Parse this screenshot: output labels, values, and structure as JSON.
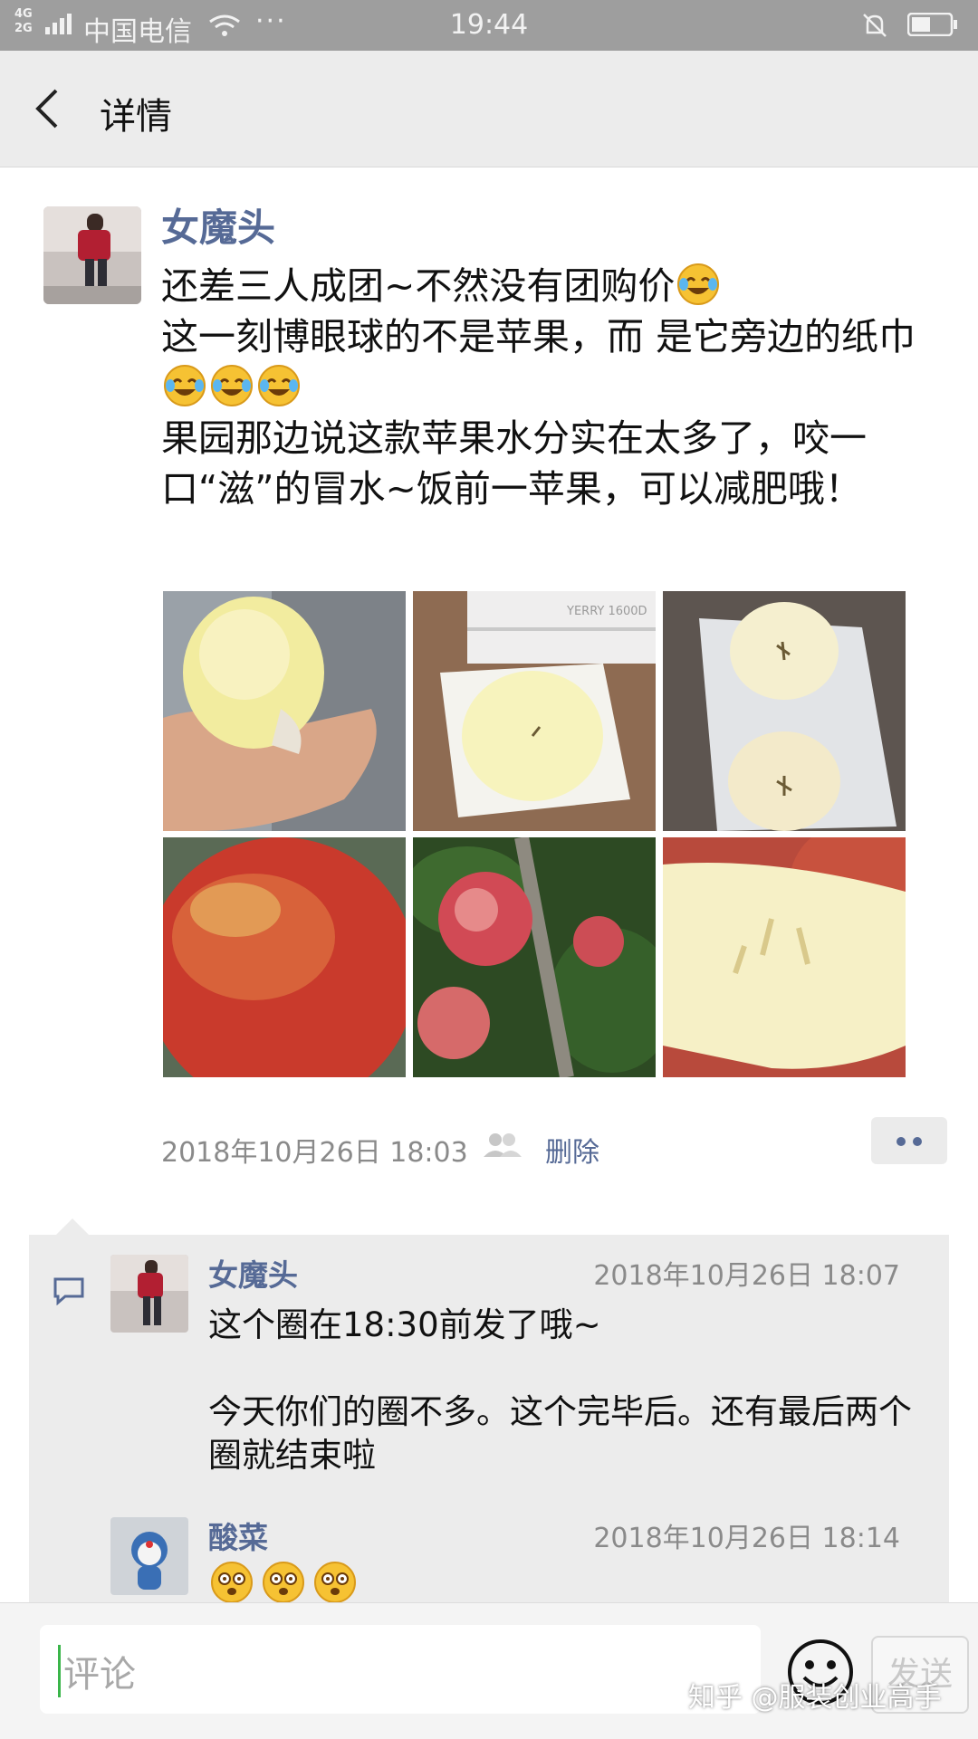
{
  "status_bar": {
    "network": "4G\n2G",
    "carrier": "中国电信",
    "dots": "···",
    "time": "19:44"
  },
  "nav": {
    "title": "详情"
  },
  "post": {
    "author": "女魔头",
    "text_line1": "还差三人成团~不然没有团购价",
    "text_line2": "这一刻博眼球的不是苹果，而 是它旁边的纸巾",
    "text_line3": "果园那边说这款苹果水分实在太多了，咬一口“滋”的冒水~饭前一苹果，可以减肥哦！",
    "time": "2018年10月26日 18:03",
    "delete_label": "删除",
    "images": [
      {
        "name": "apple-bitten-in-hand"
      },
      {
        "name": "apple-cut-on-napkin"
      },
      {
        "name": "apple-slices-on-plastic"
      },
      {
        "name": "red-apple-closeup"
      },
      {
        "name": "apples-on-tree"
      },
      {
        "name": "apple-cut-wedge"
      }
    ],
    "box_label": "YERRY 1600D"
  },
  "comments": [
    {
      "author": "女魔头",
      "time": "2018年10月26日 18:07",
      "text": "这个圈在18:30前发了哦~\n\n今天你们的圈不多。这个完毕后。还有最后两个圈就结束啦"
    },
    {
      "author": "酸菜",
      "time": "2018年10月26日 18:14",
      "emoji_count": 3
    }
  ],
  "input": {
    "placeholder": "评论",
    "send_label": "发送"
  },
  "watermark": "知乎 @服装创业高手",
  "colors": {
    "link": "#566a96",
    "status_bar": "#9e9e9e",
    "nav_bg": "#ececec",
    "comment_bg": "#ececec"
  }
}
